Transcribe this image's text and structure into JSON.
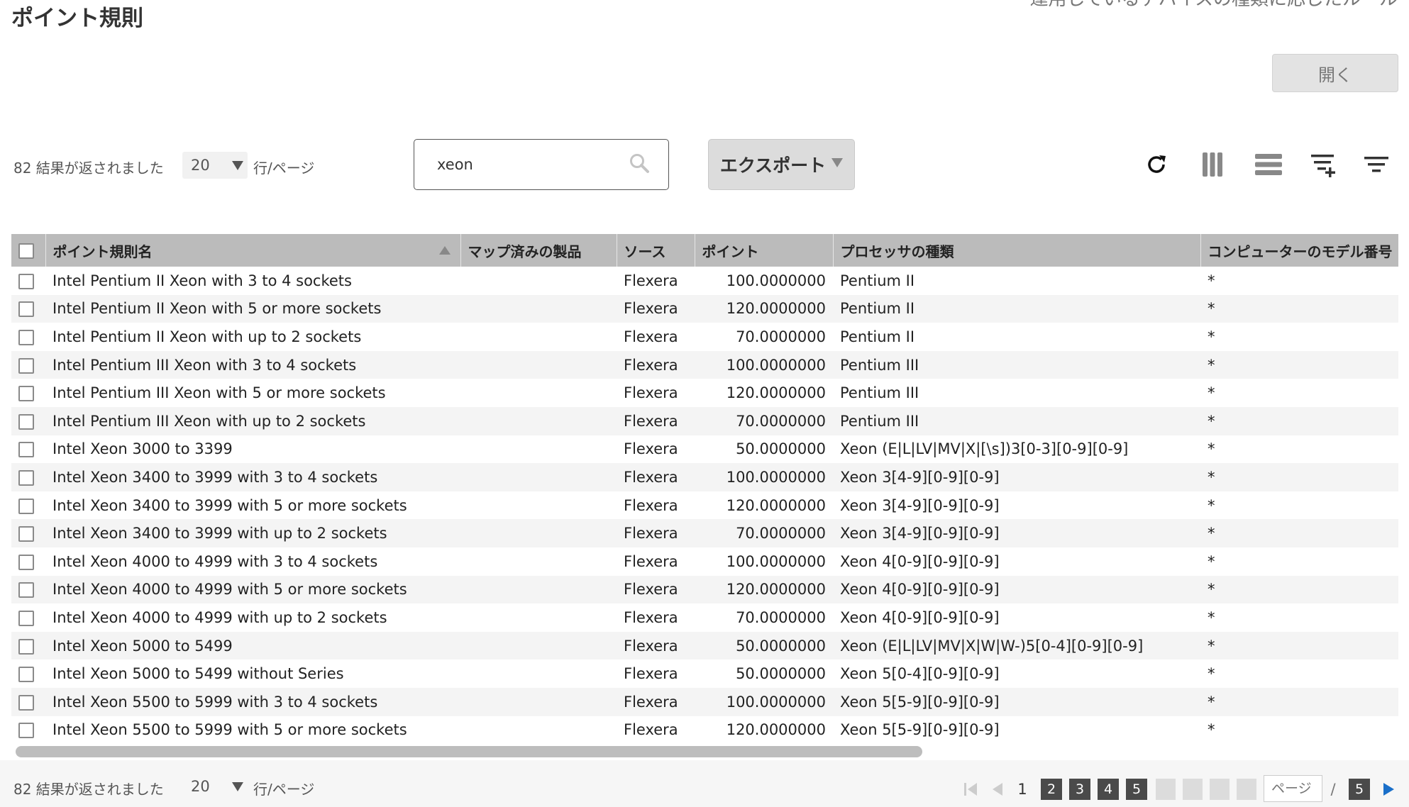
{
  "page": {
    "title": "ポイント規則",
    "top_right_text": "運用しているデバイスの種類に応じたルール",
    "open_button": "開く"
  },
  "toolbar": {
    "results_text": "82 結果が返されました",
    "per_page_value": "20",
    "per_page_suffix": "行/ページ",
    "search_value": "xeon",
    "export_label": "エクスポート"
  },
  "table": {
    "columns": [
      "ポイント規則名",
      "マップ済みの製品",
      "ソース",
      "ポイント",
      "プロセッサの種類",
      "コンピューターのモデル番号"
    ],
    "rows": [
      {
        "name": "Intel Pentium II Xeon with 3 to 4 sockets",
        "mapped": "",
        "source": "Flexera",
        "points": "100.0000000",
        "processor": "Pentium II",
        "model": "*"
      },
      {
        "name": "Intel Pentium II Xeon with 5 or more sockets",
        "mapped": "",
        "source": "Flexera",
        "points": "120.0000000",
        "processor": "Pentium II",
        "model": "*"
      },
      {
        "name": "Intel Pentium II Xeon with up to 2 sockets",
        "mapped": "",
        "source": "Flexera",
        "points": "70.0000000",
        "processor": "Pentium II",
        "model": "*"
      },
      {
        "name": "Intel Pentium III Xeon with 3 to 4 sockets",
        "mapped": "",
        "source": "Flexera",
        "points": "100.0000000",
        "processor": "Pentium III",
        "model": "*"
      },
      {
        "name": "Intel Pentium III Xeon with 5 or more sockets",
        "mapped": "",
        "source": "Flexera",
        "points": "120.0000000",
        "processor": "Pentium III",
        "model": "*"
      },
      {
        "name": "Intel Pentium III Xeon with up to 2 sockets",
        "mapped": "",
        "source": "Flexera",
        "points": "70.0000000",
        "processor": "Pentium III",
        "model": "*"
      },
      {
        "name": "Intel Xeon 3000 to 3399",
        "mapped": "",
        "source": "Flexera",
        "points": "50.0000000",
        "processor": "Xeon (E|L|LV|MV|X|[\\s])3[0-3][0-9][0-9]",
        "model": "*"
      },
      {
        "name": "Intel Xeon 3400 to 3999 with 3 to 4 sockets",
        "mapped": "",
        "source": "Flexera",
        "points": "100.0000000",
        "processor": "Xeon 3[4-9][0-9][0-9]",
        "model": "*"
      },
      {
        "name": "Intel Xeon 3400 to 3999 with 5 or more sockets",
        "mapped": "",
        "source": "Flexera",
        "points": "120.0000000",
        "processor": "Xeon 3[4-9][0-9][0-9]",
        "model": "*"
      },
      {
        "name": "Intel Xeon 3400 to 3999 with up to 2 sockets",
        "mapped": "",
        "source": "Flexera",
        "points": "70.0000000",
        "processor": "Xeon 3[4-9][0-9][0-9]",
        "model": "*"
      },
      {
        "name": "Intel Xeon 4000 to 4999 with 3 to 4 sockets",
        "mapped": "",
        "source": "Flexera",
        "points": "100.0000000",
        "processor": "Xeon 4[0-9][0-9][0-9]",
        "model": "*"
      },
      {
        "name": "Intel Xeon 4000 to 4999 with 5 or more sockets",
        "mapped": "",
        "source": "Flexera",
        "points": "120.0000000",
        "processor": "Xeon 4[0-9][0-9][0-9]",
        "model": "*"
      },
      {
        "name": "Intel Xeon 4000 to 4999 with up to 2 sockets",
        "mapped": "",
        "source": "Flexera",
        "points": "70.0000000",
        "processor": "Xeon 4[0-9][0-9][0-9]",
        "model": "*"
      },
      {
        "name": "Intel Xeon 5000 to 5499",
        "mapped": "",
        "source": "Flexera",
        "points": "50.0000000",
        "processor": "Xeon (E|L|LV|MV|X|W|W-)5[0-4][0-9][0-9]",
        "model": "*"
      },
      {
        "name": "Intel Xeon 5000 to 5499 without Series",
        "mapped": "",
        "source": "Flexera",
        "points": "50.0000000",
        "processor": "Xeon 5[0-4][0-9][0-9]",
        "model": "*"
      },
      {
        "name": "Intel Xeon 5500 to 5999 with 3 to 4 sockets",
        "mapped": "",
        "source": "Flexera",
        "points": "100.0000000",
        "processor": "Xeon 5[5-9][0-9][0-9]",
        "model": "*"
      },
      {
        "name": "Intel Xeon 5500 to 5999 with 5 or more sockets",
        "mapped": "",
        "source": "Flexera",
        "points": "120.0000000",
        "processor": "Xeon 5[5-9][0-9][0-9]",
        "model": "*"
      }
    ]
  },
  "pagination": {
    "results_text": "82 結果が返されました",
    "per_page_value": "20",
    "per_page_suffix": "行/ページ",
    "current_page": "1",
    "pages": [
      "2",
      "3",
      "4",
      "5"
    ],
    "page_input_placeholder": "ページ",
    "separator": "/",
    "total_pages": "5"
  },
  "icons": [
    "refresh-icon",
    "column-view-icon",
    "row-density-icon",
    "add-filter-icon",
    "filter-icon",
    "search-icon",
    "first-page-icon",
    "prev-page-icon",
    "next-page-icon"
  ]
}
